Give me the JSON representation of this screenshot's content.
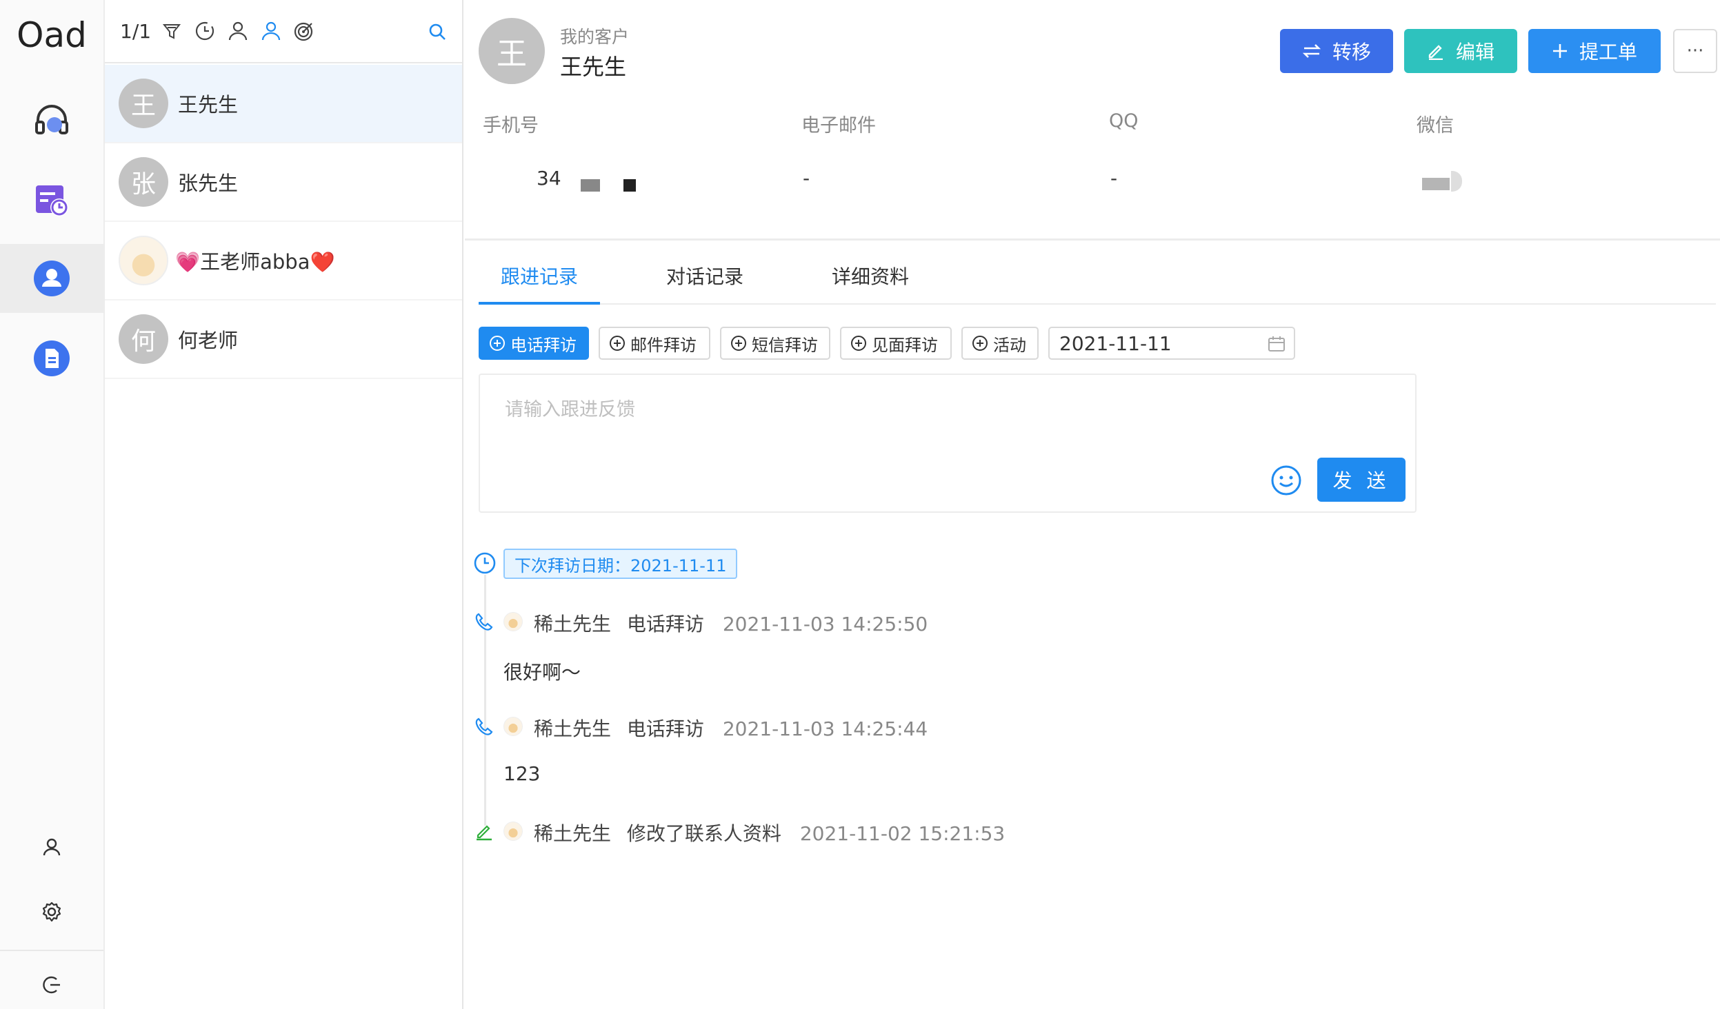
{
  "app": {
    "logo": "Oad"
  },
  "nav": {
    "items": [
      {
        "name": "headset-icon",
        "label": ""
      },
      {
        "name": "calendar-clock-icon",
        "label": ""
      },
      {
        "name": "user-circle-icon",
        "label": ""
      },
      {
        "name": "document-icon",
        "label": ""
      }
    ],
    "active_index": 2,
    "bottom": [
      "user-icon",
      "gear-icon",
      "logout-icon"
    ]
  },
  "list": {
    "count": "1/1",
    "contacts": [
      {
        "avatar_text": "王",
        "name": "王先生",
        "active": true
      },
      {
        "avatar_text": "张",
        "name": "张先生",
        "active": false
      },
      {
        "avatar_text": "",
        "name": "💗王老师abba❤️",
        "active": false,
        "avatar_image": true
      },
      {
        "avatar_text": "何",
        "name": "何老师",
        "active": false
      }
    ]
  },
  "header": {
    "avatar_text": "王",
    "breadcrumb": "我的客户",
    "title": "王先生",
    "buttons": {
      "transfer": "转移",
      "edit": "编辑",
      "ticket": "提工单",
      "more": "···"
    }
  },
  "fields": {
    "phone_label": "手机号",
    "phone_value": "34",
    "email_label": "电子邮件",
    "email_value": "-",
    "qq_label": "QQ",
    "qq_value": "-",
    "wechat_label": "微信",
    "wechat_value": ""
  },
  "tabs": [
    "跟进记录",
    "对话记录",
    "详细资料"
  ],
  "visit_types": [
    "电话拜访",
    "邮件拜访",
    "短信拜访",
    "见面拜访",
    "活动"
  ],
  "date_input": "2021-11-11",
  "editor": {
    "placeholder": "请输入跟进反馈",
    "send_label": "发 送"
  },
  "timeline": {
    "next_visit": "下次拜访日期：2021-11-11",
    "entries": [
      {
        "icon": "phone-icon",
        "author": "稀土先生",
        "action": "电话拜访",
        "time": "2021-11-03 14:25:50",
        "content": "很好啊～"
      },
      {
        "icon": "phone-icon",
        "author": "稀土先生",
        "action": "电话拜访",
        "time": "2021-11-03 14:25:44",
        "content": "123"
      },
      {
        "icon": "edit-icon",
        "author": "稀土先生",
        "action": "修改了联系人资料",
        "time": "2021-11-02 15:21:53",
        "content": ""
      }
    ]
  },
  "colors": {
    "primary": "#1f8bf0",
    "transfer": "#3b6ee8",
    "edit": "#2ec2be",
    "nav_icon": "#4a63e8"
  }
}
